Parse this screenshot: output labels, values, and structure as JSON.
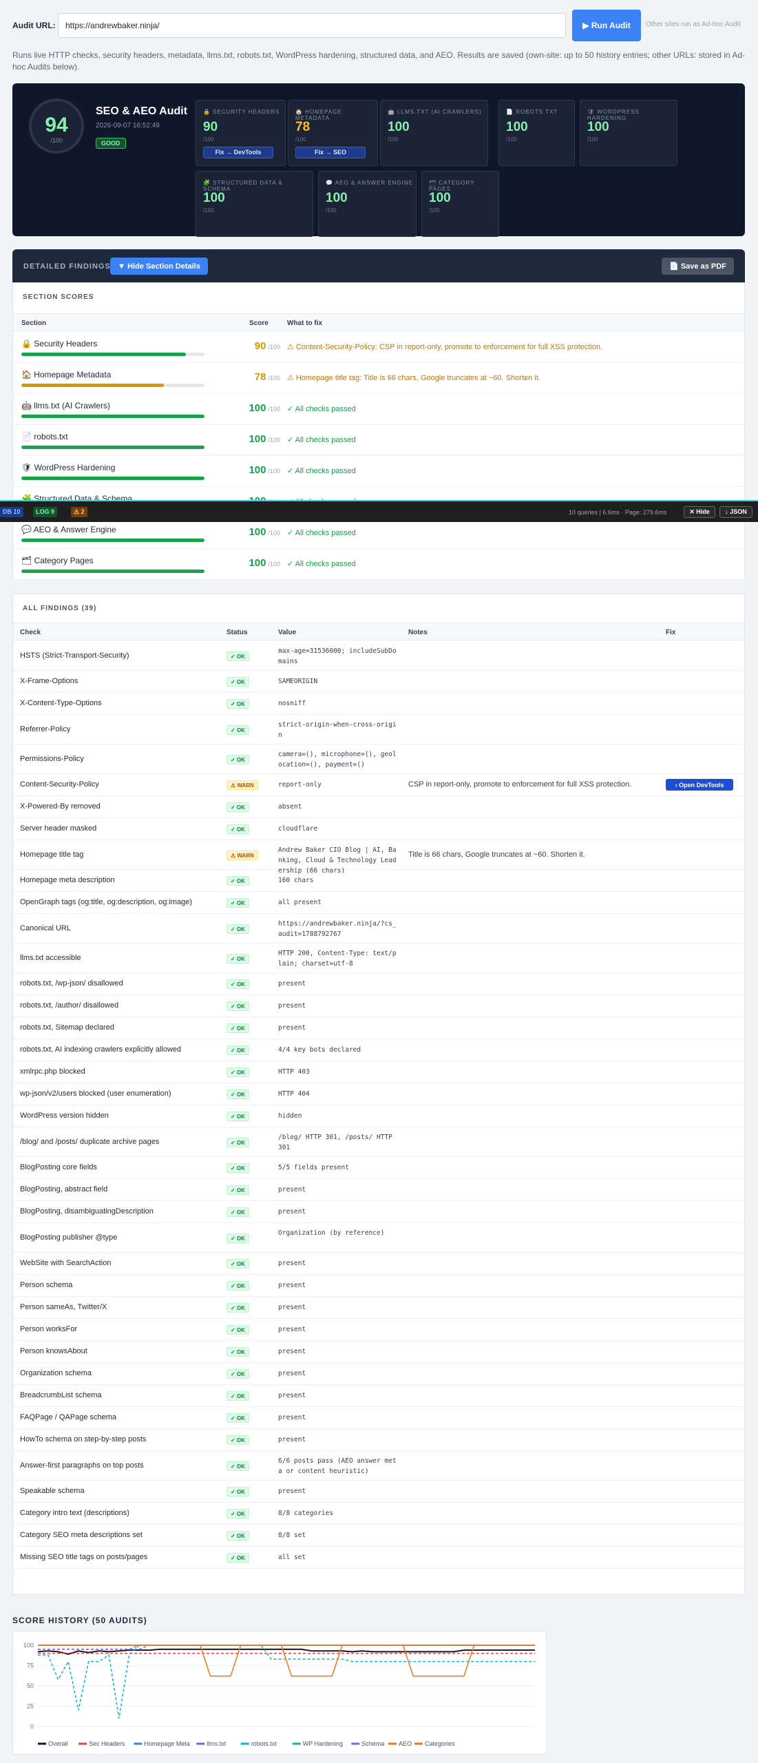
{
  "topbar": {
    "url_label": "Audit URL:",
    "url_value": "https://andrewbaker.ninja/",
    "run_label": "▶ Run Audit",
    "adhoc_note": "Other sites run as Ad-hoc Audit"
  },
  "description": "Runs live HTTP checks, security headers, metadata, llms.txt, robots.txt, WordPress hardening, structured data, and AEO. Results are saved (own-site: up to 50 history entries; other URLs: stored in Ad-hoc Audits below).",
  "hero": {
    "score": "94",
    "score_den": "/100",
    "title": "SEO & AEO Audit",
    "date": "2026-09-07 16:52:49",
    "grade": "GOOD",
    "cards": [
      {
        "title": "🔒 SECURITY HEADERS",
        "value": "90",
        "den": "/100",
        "tone": "green",
        "button": "Fix → DevTools"
      },
      {
        "title": "🏠 HOMEPAGE METADATA",
        "value": "78",
        "den": "/100",
        "tone": "amber",
        "button": "Fix → SEO"
      },
      {
        "title": "🤖 LLMS.TXT (AI CRAWLERS)",
        "value": "100",
        "den": "/100",
        "tone": "green",
        "button": ""
      },
      {
        "title": "📄 ROBOTS.TXT",
        "value": "100",
        "den": "/100",
        "tone": "green",
        "button": ""
      },
      {
        "title": "🛡 WORDPRESS HARDENING",
        "value": "100",
        "den": "/100",
        "tone": "green",
        "button": ""
      },
      {
        "title": "🧩 STRUCTURED DATA & SCHEMA",
        "value": "100",
        "den": "/100",
        "tone": "green",
        "button": ""
      },
      {
        "title": "💬 AEO & ANSWER ENGINE",
        "value": "100",
        "den": "/100",
        "tone": "green",
        "button": ""
      },
      {
        "title": "🗂 CATEGORY PAGES",
        "value": "100",
        "den": "/100",
        "tone": "green",
        "button": ""
      }
    ]
  },
  "findings_header": {
    "title": "DETAILED FINDINGS",
    "hide_label": "▼ Hide Section Details",
    "pdf_label": "📄 Save as PDF"
  },
  "section_scores": {
    "title": "SECTION SCORES",
    "headers": {
      "section": "Section",
      "score": "Score",
      "fix": "What to fix"
    },
    "den": "/100",
    "rows": [
      {
        "name": "🔒 Security Headers",
        "score": 90,
        "color": "#16a34a",
        "fix": "⚠ Content-Security-Policy: CSP in report-only, promote to enforcement for full XSS protection.",
        "warn": true
      },
      {
        "name": "🏠 Homepage Metadata",
        "score": 78,
        "color": "#d9970c",
        "fix": "⚠ Homepage title tag: Title is 66 chars, Google truncates at ~60. Shorten it.",
        "warn": true
      },
      {
        "name": "🤖 llms.txt (AI Crawlers)",
        "score": 100,
        "color": "#16a34a",
        "fix": "✓ All checks passed",
        "warn": false
      },
      {
        "name": "📄 robots.txt",
        "score": 100,
        "color": "#16a34a",
        "fix": "✓ All checks passed",
        "warn": false
      },
      {
        "name": "🛡 WordPress Hardening",
        "score": 100,
        "color": "#16a34a",
        "fix": "✓ All checks passed",
        "warn": false
      },
      {
        "name": "🧩 Structured Data & Schema",
        "score": 100,
        "color": "#16a34a",
        "fix": "✓ All checks passed",
        "warn": false
      },
      {
        "name": "💬 AEO & Answer Engine",
        "score": 100,
        "color": "#16a34a",
        "fix": "✓ All checks passed",
        "warn": false
      },
      {
        "name": "🗂 Category Pages",
        "score": 100,
        "color": "#16a34a",
        "fix": "✓ All checks passed",
        "warn": false
      }
    ]
  },
  "debug_bar": {
    "db": "DB 10",
    "log": "LOG 9",
    "warn": "⚠ 2",
    "meta": "10 queries | 6.6ms · Page: 279.6ms",
    "hide": "✕ Hide",
    "json": "↓ JSON"
  },
  "all_findings": {
    "title": "ALL FINDINGS (39)",
    "headers": {
      "check": "Check",
      "status": "Status",
      "value": "Value",
      "notes": "Notes",
      "fix": "Fix"
    },
    "rows": [
      {
        "check": "HSTS (Strict-Transport-Security)",
        "status": "✓ OK",
        "value": "max-age=31536000; includeSubDomains",
        "notes": "",
        "fix": ""
      },
      {
        "check": "X-Frame-Options",
        "status": "✓ OK",
        "value": "SAMEORIGIN",
        "notes": "",
        "fix": ""
      },
      {
        "check": "X-Content-Type-Options",
        "status": "✓ OK",
        "value": "nosniff",
        "notes": "",
        "fix": ""
      },
      {
        "check": "Referrer-Policy",
        "status": "✓ OK",
        "value": "strict-origin-when-cross-origin",
        "notes": "",
        "fix": ""
      },
      {
        "check": "Permissions-Policy",
        "status": "✓ OK",
        "value": "camera=(), microphone=(), geolocation=(), payment=()",
        "notes": "",
        "fix": ""
      },
      {
        "check": "Content-Security-Policy",
        "status": "⚠ WARN",
        "value": "report-only",
        "notes": "CSP in report-only, promote to enforcement for full XSS protection.",
        "fix": "› Open DevTools"
      },
      {
        "check": "X-Powered-By removed",
        "status": "✓ OK",
        "value": "absent",
        "notes": "",
        "fix": ""
      },
      {
        "check": "Server header masked",
        "status": "✓ OK",
        "value": "cloudflare",
        "notes": "",
        "fix": ""
      },
      {
        "check": "Homepage title tag",
        "status": "⚠ WARN",
        "value": "Andrew Baker CIO Blog | AI, Banking, Cloud & Technology Leadership (66 chars)",
        "notes": "Title is 66 chars, Google truncates at ~60. Shorten it.",
        "fix": ""
      },
      {
        "check": "Homepage meta description",
        "status": "✓ OK",
        "value": "160 chars",
        "notes": "",
        "fix": ""
      },
      {
        "check": "OpenGraph tags (og:title, og:description, og:image)",
        "status": "✓ OK",
        "value": "all present",
        "notes": "",
        "fix": ""
      },
      {
        "check": "Canonical URL",
        "status": "✓ OK",
        "value": "https://andrewbaker.ninja/?cs_audit=1788792767",
        "notes": "",
        "fix": ""
      },
      {
        "check": "llms.txt accessible",
        "status": "✓ OK",
        "value": "HTTP 200, Content-Type: text/plain; charset=utf-8",
        "notes": "",
        "fix": ""
      },
      {
        "check": "robots.txt, /wp-json/ disallowed",
        "status": "✓ OK",
        "value": "present",
        "notes": "",
        "fix": ""
      },
      {
        "check": "robots.txt, /author/ disallowed",
        "status": "✓ OK",
        "value": "present",
        "notes": "",
        "fix": ""
      },
      {
        "check": "robots.txt, Sitemap declared",
        "status": "✓ OK",
        "value": "present",
        "notes": "",
        "fix": ""
      },
      {
        "check": "robots.txt, AI indexing crawlers explicitly allowed",
        "status": "✓ OK",
        "value": "4/4 key bots declared",
        "notes": "",
        "fix": ""
      },
      {
        "check": "xmlrpc.php blocked",
        "status": "✓ OK",
        "value": "HTTP 403",
        "notes": "",
        "fix": ""
      },
      {
        "check": "wp-json/v2/users blocked (user enumeration)",
        "status": "✓ OK",
        "value": "HTTP 404",
        "notes": "",
        "fix": ""
      },
      {
        "check": "WordPress version hidden",
        "status": "✓ OK",
        "value": "hidden",
        "notes": "",
        "fix": ""
      },
      {
        "check": "/blog/ and /posts/ duplicate archive pages",
        "status": "✓ OK",
        "value": "/blog/ HTTP 301, /posts/ HTTP 301",
        "notes": "",
        "fix": ""
      },
      {
        "check": "BlogPosting core fields",
        "status": "✓ OK",
        "value": "5/5 fields present",
        "notes": "",
        "fix": ""
      },
      {
        "check": "BlogPosting, abstract field",
        "status": "✓ OK",
        "value": "present",
        "notes": "",
        "fix": ""
      },
      {
        "check": "BlogPosting, disambiguatingDescription",
        "status": "✓ OK",
        "value": "present",
        "notes": "",
        "fix": ""
      },
      {
        "check": "BlogPosting publisher @type",
        "status": "✓ OK",
        "value": "Organization (by reference)",
        "notes": "",
        "fix": ""
      },
      {
        "check": "WebSite with SearchAction",
        "status": "✓ OK",
        "value": "present",
        "notes": "",
        "fix": ""
      },
      {
        "check": "Person schema",
        "status": "✓ OK",
        "value": "present",
        "notes": "",
        "fix": ""
      },
      {
        "check": "Person sameAs, Twitter/X",
        "status": "✓ OK",
        "value": "present",
        "notes": "",
        "fix": ""
      },
      {
        "check": "Person worksFor",
        "status": "✓ OK",
        "value": "present",
        "notes": "",
        "fix": ""
      },
      {
        "check": "Person knowsAbout",
        "status": "✓ OK",
        "value": "present",
        "notes": "",
        "fix": ""
      },
      {
        "check": "Organization schema",
        "status": "✓ OK",
        "value": "present",
        "notes": "",
        "fix": ""
      },
      {
        "check": "BreadcrumbList schema",
        "status": "✓ OK",
        "value": "present",
        "notes": "",
        "fix": ""
      },
      {
        "check": "FAQPage / QAPage schema",
        "status": "✓ OK",
        "value": "present",
        "notes": "",
        "fix": ""
      },
      {
        "check": "HowTo schema on step-by-step posts",
        "status": "✓ OK",
        "value": "present",
        "notes": "",
        "fix": ""
      },
      {
        "check": "Answer-first paragraphs on top posts",
        "status": "✓ OK",
        "value": "6/6 posts pass (AEO answer meta or content heuristic)",
        "notes": "",
        "fix": ""
      },
      {
        "check": "Speakable schema",
        "status": "✓ OK",
        "value": "present",
        "notes": "",
        "fix": ""
      },
      {
        "check": "Category intro text (descriptions)",
        "status": "✓ OK",
        "value": "8/8 categories",
        "notes": "",
        "fix": ""
      },
      {
        "check": "Category SEO meta descriptions set",
        "status": "✓ OK",
        "value": "8/8 set",
        "notes": "",
        "fix": ""
      },
      {
        "check": "Missing SEO title tags on posts/pages",
        "status": "✓ OK",
        "value": "all set",
        "notes": "",
        "fix": ""
      }
    ]
  },
  "history": {
    "title": "SCORE HISTORY (50 AUDITS)"
  },
  "chart_data": {
    "type": "line",
    "title": "",
    "ylim": [
      0,
      100
    ],
    "yticks": [
      0,
      25,
      50,
      75,
      100
    ],
    "legend_position": "bottom",
    "x": [
      1,
      2,
      3,
      4,
      5,
      6,
      7,
      8,
      9,
      10,
      11,
      12,
      13,
      14,
      15,
      16,
      17,
      18,
      19,
      20,
      21,
      22,
      23,
      24,
      25,
      26,
      27,
      28,
      29,
      30,
      31,
      32,
      33,
      34,
      35,
      36,
      37,
      38,
      39,
      40,
      41,
      42,
      43,
      44,
      45,
      46,
      47,
      48,
      49,
      50
    ],
    "series": [
      {
        "name": "Overall",
        "color": "#111827",
        "dash": "",
        "values": [
          92,
          93,
          92,
          89,
          93,
          91,
          93,
          92,
          93,
          94,
          94,
          94,
          95,
          95,
          95,
          95,
          95,
          95,
          95,
          95,
          95,
          95,
          95,
          95,
          95,
          95,
          95,
          93,
          93,
          93,
          93,
          92,
          93,
          92,
          92,
          92,
          92,
          92,
          92,
          92,
          92,
          92,
          94,
          94,
          94,
          94,
          94,
          94,
          94,
          94
        ]
      },
      {
        "name": "Sec Headers",
        "color": "#ef4444",
        "dash": "4 3",
        "values": [
          90,
          90,
          90,
          90,
          90,
          90,
          90,
          90,
          90,
          90,
          90,
          90,
          90,
          90,
          90,
          90,
          90,
          90,
          90,
          90,
          90,
          90,
          90,
          90,
          90,
          90,
          90,
          90,
          90,
          90,
          90,
          90,
          90,
          90,
          90,
          90,
          90,
          90,
          90,
          90,
          90,
          90,
          90,
          90,
          90,
          90,
          90,
          90,
          90,
          90
        ]
      },
      {
        "name": "Homepage Meta",
        "color": "#3b82f6",
        "dash": "4 3",
        "values": [
          95,
          95,
          95,
          95,
          95,
          95,
          95,
          95,
          95,
          95,
          95,
          100,
          100,
          100,
          100,
          100,
          100,
          100,
          100,
          100,
          100,
          100,
          100,
          100,
          100,
          100,
          100,
          100,
          100,
          100,
          100,
          100,
          100,
          100,
          100,
          100,
          100,
          100,
          100,
          100,
          100,
          100,
          100,
          100,
          100,
          100,
          100,
          100,
          100,
          100
        ]
      },
      {
        "name": "llms.txt",
        "color": "#6366f1",
        "dash": "",
        "values": [
          100,
          100,
          100,
          100,
          100,
          100,
          100,
          100,
          100,
          100,
          100,
          100,
          100,
          100,
          100,
          100,
          100,
          100,
          100,
          100,
          100,
          100,
          100,
          100,
          100,
          100,
          100,
          100,
          100,
          100,
          100,
          100,
          100,
          100,
          100,
          100,
          100,
          100,
          100,
          100,
          100,
          100,
          100,
          100,
          100,
          100,
          100,
          100,
          100,
          100
        ]
      },
      {
        "name": "robots.txt",
        "color": "#06b6d4",
        "dash": "4 3",
        "values": [
          88,
          88,
          58,
          80,
          20,
          80,
          80,
          88,
          10,
          88,
          100,
          100,
          100,
          100,
          100,
          100,
          100,
          100,
          100,
          100,
          100,
          100,
          100,
          83,
          83,
          83,
          83,
          83,
          83,
          83,
          83,
          80,
          80,
          80,
          80,
          80,
          80,
          80,
          80,
          80,
          80,
          80,
          80,
          80,
          80,
          80,
          80,
          80,
          80,
          80
        ]
      },
      {
        "name": "WP Hardening",
        "color": "#10b981",
        "dash": "",
        "values": [
          100,
          100,
          100,
          100,
          100,
          100,
          100,
          100,
          100,
          100,
          100,
          100,
          100,
          100,
          100,
          100,
          100,
          100,
          100,
          100,
          100,
          100,
          100,
          100,
          100,
          100,
          100,
          100,
          100,
          100,
          100,
          100,
          100,
          100,
          100,
          100,
          100,
          100,
          100,
          100,
          100,
          100,
          100,
          100,
          100,
          100,
          100,
          100,
          100,
          100
        ]
      },
      {
        "name": "Schema",
        "color": "#8b5cf6",
        "dash": "4 3",
        "values": [
          95,
          95,
          95,
          95,
          95,
          95,
          95,
          95,
          95,
          95,
          100,
          100,
          100,
          100,
          100,
          100,
          100,
          100,
          100,
          100,
          100,
          100,
          100,
          100,
          100,
          100,
          100,
          100,
          100,
          100,
          100,
          100,
          100,
          100,
          100,
          100,
          100,
          100,
          100,
          100,
          100,
          100,
          100,
          100,
          100,
          100,
          100,
          100,
          100,
          100
        ]
      },
      {
        "name": "AEO",
        "color": "#f97316",
        "dash": "",
        "values": [
          100,
          100,
          100,
          100,
          100,
          100,
          100,
          100,
          100,
          100,
          100,
          100,
          100,
          100,
          100,
          100,
          100,
          62,
          62,
          62,
          100,
          100,
          100,
          100,
          100,
          62,
          62,
          62,
          62,
          62,
          100,
          100,
          100,
          100,
          100,
          100,
          100,
          62,
          62,
          62,
          62,
          62,
          62,
          100,
          100,
          100,
          100,
          100,
          100,
          100
        ]
      },
      {
        "name": "Categories",
        "color": "#ea7a1e",
        "dash": "",
        "values": [
          100,
          100,
          100,
          100,
          100,
          100,
          100,
          100,
          100,
          100,
          100,
          100,
          100,
          100,
          100,
          100,
          100,
          100,
          100,
          100,
          100,
          100,
          100,
          100,
          100,
          100,
          100,
          100,
          100,
          100,
          100,
          100,
          100,
          100,
          100,
          100,
          100,
          100,
          100,
          100,
          100,
          100,
          100,
          100,
          100,
          100,
          100,
          100,
          100,
          100
        ]
      }
    ]
  }
}
